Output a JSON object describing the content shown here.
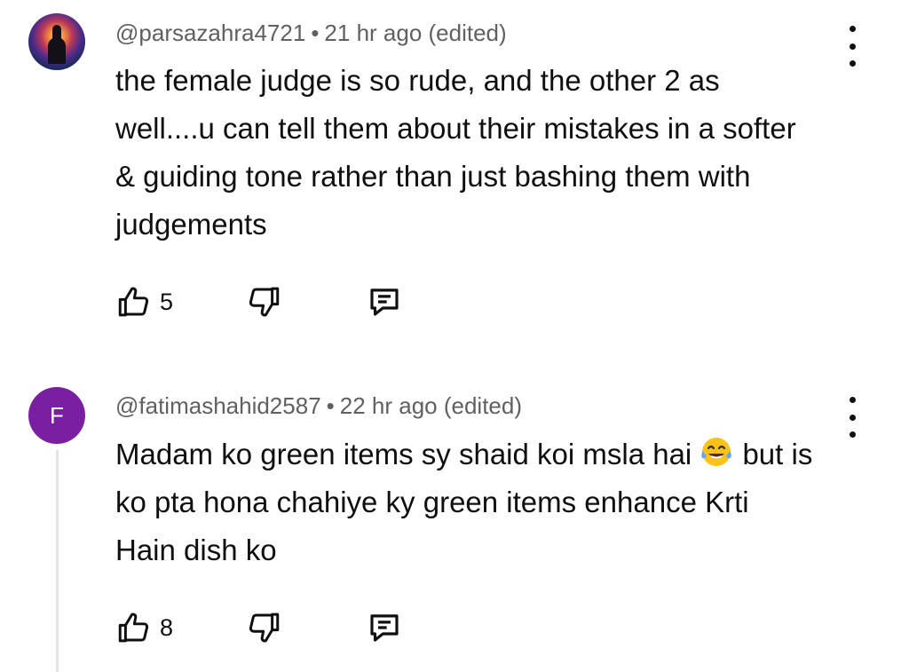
{
  "comments": [
    {
      "handle": "@parsazahra4721",
      "separator": "•",
      "time": "21 hr ago (edited)",
      "text": "the female judge is so rude, and the other 2 as well....u can tell them about their mistakes in a softer & guiding tone rather than just bashing them with judgements",
      "likes": "5",
      "avatar": "image-avatar"
    },
    {
      "handle": "@fatimashahid2587",
      "separator": "•",
      "time": "22 hr ago (edited)",
      "text": "Madam ko green items sy shaid koi msla hai",
      "text_emoji": "face-with-tears-of-joy-emoji",
      "text_rest": "but is ko pta hona chahiye ky green items enhance Krti Hain dish ko",
      "likes": "8",
      "avatar_letter": "F",
      "avatar_color": "#7b1fa2"
    }
  ],
  "icons": {
    "like": "thumbs-up-icon",
    "dislike": "thumbs-down-icon",
    "reply": "comment-icon",
    "menu": "more-vertical-icon"
  }
}
